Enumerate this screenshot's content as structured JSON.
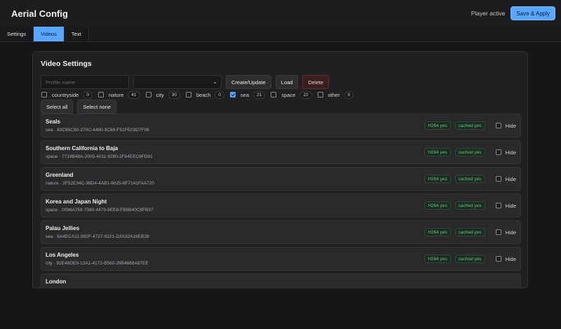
{
  "app": {
    "title": "Aerial Config",
    "status": "Player active",
    "save_label": "Save & Apply"
  },
  "tabs": [
    {
      "label": "Settings",
      "active": false
    },
    {
      "label": "Videos",
      "active": true
    },
    {
      "label": "Text",
      "active": false
    }
  ],
  "panel": {
    "title": "Video Settings",
    "profile_placeholder": "Profile name",
    "profile_value": "",
    "profile_select_value": "",
    "create_label": "Create/Update",
    "load_label": "Load",
    "delete_label": "Delete",
    "select_all_label": "Select all",
    "select_none_label": "Select none"
  },
  "filters": [
    {
      "label": "countryside",
      "count": "0",
      "checked": false
    },
    {
      "label": "nature",
      "count": "41",
      "checked": false
    },
    {
      "label": "city",
      "count": "30",
      "checked": false
    },
    {
      "label": "beach",
      "count": "0",
      "checked": false
    },
    {
      "label": "sea",
      "count": "21",
      "checked": true
    },
    {
      "label": "space",
      "count": "22",
      "checked": false
    },
    {
      "label": "other",
      "count": "0",
      "checked": false
    }
  ],
  "videos": [
    {
      "title": "Seals",
      "sub": "sea · 83C65C90-270C-4490-9C69-F51FE03D7F06",
      "codec": "H264 yes",
      "cached": "cached yes",
      "hide_label": "Hide",
      "hidden": false
    },
    {
      "title": "Southern California to Baja",
      "sub": "space · 7719B48A-2005-4011-9280-2F64EEC6FD91",
      "codec": "H264 yes",
      "cached": "cached yes",
      "hide_label": "Hide",
      "hidden": false
    },
    {
      "title": "Greenland",
      "sub": "nature · 2F52E34C-39D4-4AB1-9025-8F7141FAA720",
      "codec": "H264 yes",
      "cached": "cached yes",
      "hide_label": "Hide",
      "hidden": false
    },
    {
      "title": "Korea and Japan Night",
      "sub": "space · 0098A758-7060-4479-8EE8-FB9B40C8FB97",
      "codec": "H264 yes",
      "cached": "cached yes",
      "hide_label": "Hide",
      "hidden": false
    },
    {
      "title": "Palau Jellies",
      "sub": "sea · 8A4ECA11-592F-4727-9221-D2A32A16EB28",
      "codec": "H264 yes",
      "cached": "cached yes",
      "hide_label": "Hide",
      "hidden": false
    },
    {
      "title": "Los Angeles",
      "sub": "city · 92E48DE9-13A1-4172-B560-29B4668A87EE",
      "codec": "H264 yes",
      "cached": "cached yes",
      "hide_label": "Hide",
      "hidden": false
    },
    {
      "title": "London",
      "sub": "",
      "codec": "",
      "cached": "",
      "hide_label": "",
      "hidden": false
    }
  ]
}
